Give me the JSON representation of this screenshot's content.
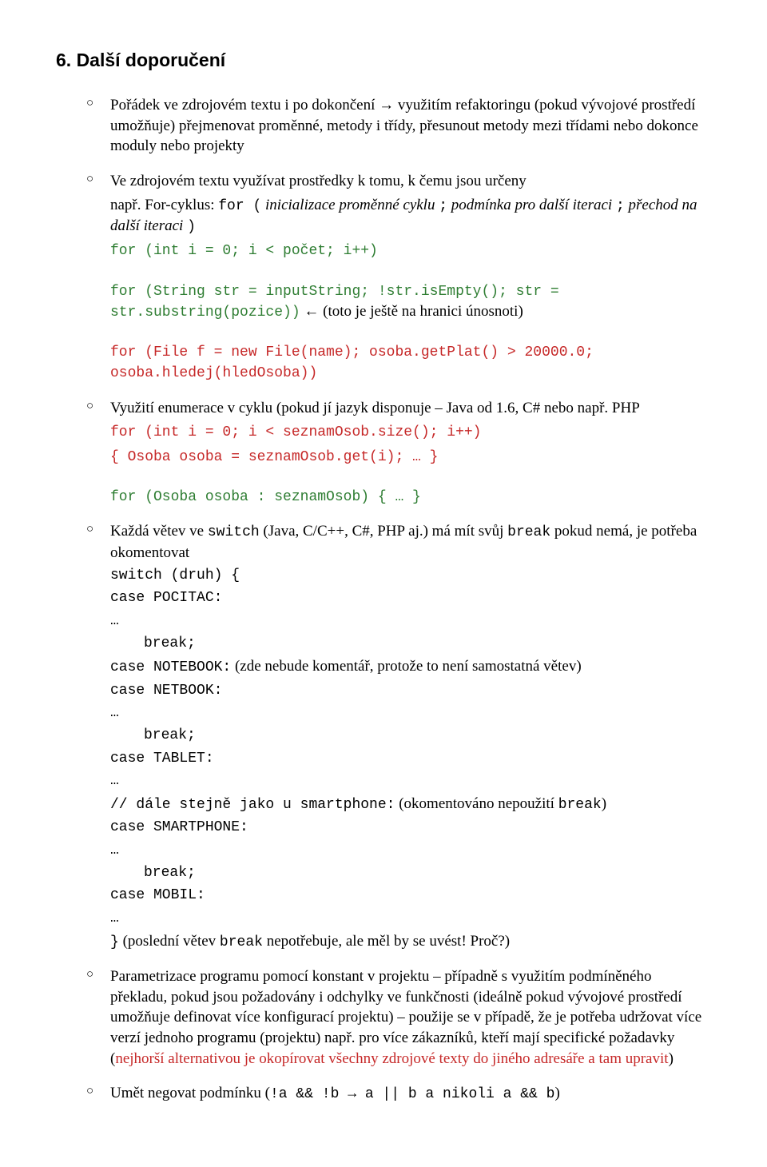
{
  "heading": "6. Další doporučení",
  "items": [
    {
      "intro_parts": [
        {
          "t": "Pořádek ve zdrojovém textu i po dokončení → využitím refaktoringu (pokud vývojové prostředí umožňuje) přejmenovat proměnné, metody i třídy, přesunout metody mezi třídami nebo dokonce moduly nebo projekty"
        }
      ]
    },
    {
      "intro_parts": [
        {
          "t": "Ve zdrojovém textu využívat prostředky k tomu, k čemu jsou určeny"
        }
      ],
      "para2": [
        {
          "t": "např. For-cyklus: "
        },
        {
          "t": "for (",
          "cls": "mono"
        },
        {
          "t": " inicializace proměnné cyklu ",
          "cls": "italic"
        },
        {
          "t": ";",
          "cls": "mono"
        },
        {
          "t": " podmínka pro další iteraci ",
          "cls": "italic"
        },
        {
          "t": ";",
          "cls": "mono"
        },
        {
          "t": " přechod na další iteraci ",
          "cls": "italic"
        },
        {
          "t": ")",
          "cls": "mono"
        }
      ],
      "code1": "for (int i = 0; i < počet; i++)",
      "code2a": "for (String str = inputString; !str.isEmpty(); str = str.substring(pozice))",
      "code2b_note": " ← (toto je ještě na hranici únosnoti)",
      "code3": "for (File f = new File(name); osoba.getPlat() > 20000.0; osoba.hledej(hledOsoba))"
    },
    {
      "intro_parts": [
        {
          "t": "Využití enumerace v cyklu (pokud jí jazyk disponuje – Java od 1.6, C# nebo např. PHP"
        }
      ],
      "code1": "for (int i = 0; i < seznamOsob.size(); i++)",
      "code2": "  { Osoba osoba = seznamOsob.get(i); … }",
      "code3": "for (Osoba osoba : seznamOsob) { … }"
    },
    {
      "intro_parts": [
        {
          "t": "Každá větev ve "
        },
        {
          "t": "switch",
          "cls": "mono"
        },
        {
          "t": " (Java, C/C++, C#, PHP aj.) má mít svůj "
        },
        {
          "t": "break",
          "cls": "mono"
        },
        {
          "t": " pokud nemá, je potřeba okomentovat"
        }
      ],
      "switch": {
        "l1": "switch (druh) {",
        "l2": " case POCITAC:",
        "l3": "…",
        "l4": "break;",
        "l5a": " case NOTEBOOK:",
        "l5b": "  (zde nebude komentář, protože to není samostatná větev)",
        "l6": " case NETBOOK:",
        "l7": "…",
        "l8": "break;",
        "l9": " case TABLET:",
        "l10": "…",
        "l11a": " // dále stejně jako u smartphone:",
        "l11b": " (okomentováno nepoužití ",
        "l11c": "break",
        "l11d": ")",
        "l12": " case SMARTPHONE:",
        "l13": "…",
        "l14": "break;",
        "l15": " case MOBIL:",
        "l16": "…",
        "l17a": "}",
        "l17b": " (poslední větev ",
        "l17c": "break",
        "l17d": "  nepotřebuje, ale měl by se uvést! Proč?)"
      }
    },
    {
      "intro_parts": [
        {
          "t": "Parametrizace programu pomocí konstant v projektu – případně s využitím podmíněného překladu, pokud jsou požadovány i odchylky ve funkčnosti  (ideálně pokud vývojové prostředí umožňuje definovat více konfigurací projektu) – použije se v případě, že je potřeba udržovat více verzí jednoho programu (projektu) např. pro více zákazníků, kteří mají specifické požadavky ("
        },
        {
          "t": "nejhorší alternativou je okopírovat všechny zdrojové texty do jiného adresáře a tam upravit",
          "cls": "red"
        },
        {
          "t": ")"
        }
      ]
    },
    {
      "intro_parts": [
        {
          "t": "Umět negovat podmínku ("
        },
        {
          "t": "!a && !b → a || b a nikoli a && b",
          "cls": "mono"
        },
        {
          "t": ")"
        }
      ]
    }
  ]
}
